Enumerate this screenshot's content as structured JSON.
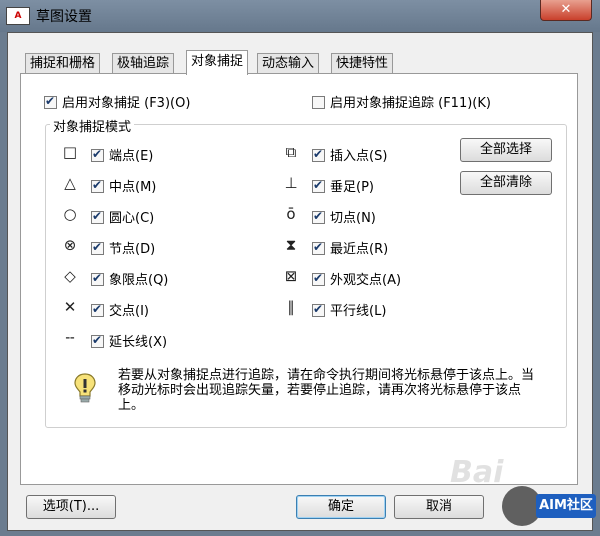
{
  "window": {
    "title": "草图设置",
    "app_icon": "A"
  },
  "tabs": [
    {
      "label": "捕捉和栅格",
      "active": false
    },
    {
      "label": "极轴追踪",
      "active": false
    },
    {
      "label": "对象捕捉",
      "active": true
    },
    {
      "label": "动态输入",
      "active": false
    },
    {
      "label": "快捷特性",
      "active": false
    }
  ],
  "enable_osnap": {
    "label": "启用对象捕捉 (F3)(O)",
    "checked": true
  },
  "enable_tracking": {
    "label": "启用对象捕捉追踪 (F11)(K)",
    "checked": false
  },
  "group_title": "对象捕捉模式",
  "modes_left": [
    {
      "label": "端点(E)",
      "icon": "square-icon",
      "glyph": "□",
      "checked": true
    },
    {
      "label": "中点(M)",
      "icon": "triangle-icon",
      "glyph": "△",
      "checked": true
    },
    {
      "label": "圆心(C)",
      "icon": "circle-icon",
      "glyph": "○",
      "checked": true
    },
    {
      "label": "节点(D)",
      "icon": "node-icon",
      "glyph": "⊗",
      "checked": true
    },
    {
      "label": "象限点(Q)",
      "icon": "diamond-icon",
      "glyph": "◇",
      "checked": true
    },
    {
      "label": "交点(I)",
      "icon": "cross-icon",
      "glyph": "✕",
      "checked": true
    },
    {
      "label": "延长线(X)",
      "icon": "extension-icon",
      "glyph": "╌",
      "checked": true
    }
  ],
  "modes_right": [
    {
      "label": "插入点(S)",
      "icon": "insert-icon",
      "glyph": "⧉",
      "checked": true
    },
    {
      "label": "垂足(P)",
      "icon": "perpendicular-icon",
      "glyph": "⊥",
      "checked": true
    },
    {
      "label": "切点(N)",
      "icon": "tangent-icon",
      "glyph": "ō",
      "checked": true
    },
    {
      "label": "最近点(R)",
      "icon": "nearest-icon",
      "glyph": "⧗",
      "checked": true
    },
    {
      "label": "外观交点(A)",
      "icon": "apparent-intersection-icon",
      "glyph": "⊠",
      "checked": true
    },
    {
      "label": "平行线(L)",
      "icon": "parallel-icon",
      "glyph": "∥",
      "checked": true
    }
  ],
  "buttons": {
    "select_all": "全部选择",
    "clear_all": "全部清除",
    "options": "选项(T)...",
    "ok": "确定",
    "cancel": "取消"
  },
  "info_text": "若要从对象捕捉点进行追踪，请在命令执行期间将光标悬停于该点上。当移动光标时会出现追踪矢量，若要停止追踪，请再次将光标悬停于该点上。",
  "watermark": {
    "text": "Bai",
    "badge": "AIM社区"
  }
}
